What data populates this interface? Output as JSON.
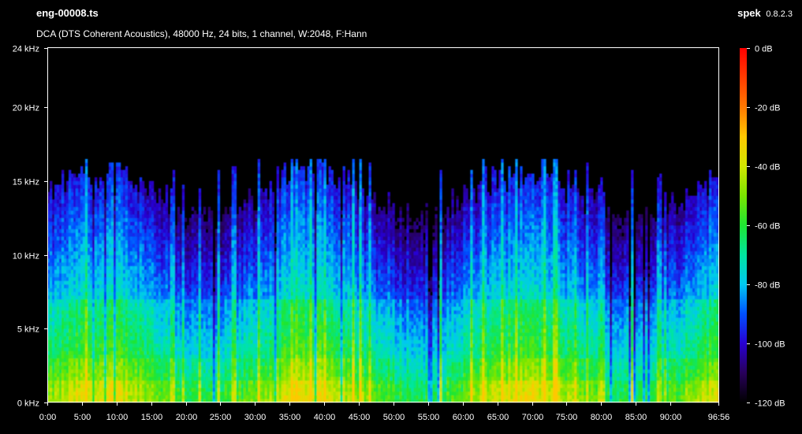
{
  "header": {
    "file_name": "eng-00008.ts",
    "app_name": "spek",
    "app_version": "0.8.2.3",
    "info": "DCA (DTS Coherent Acoustics), 48000 Hz, 24 bits, 1 channel, W:2048, F:Hann"
  },
  "chart_data": {
    "type": "heatmap",
    "title": "",
    "xlabel": "",
    "ylabel": "",
    "x_unit": "time (min:sec)",
    "y_unit": "kHz",
    "xlim_seconds": [
      0,
      5816
    ],
    "ylim_khz": [
      0,
      24
    ],
    "x_ticks": [
      {
        "label": "0:00",
        "seconds": 0
      },
      {
        "label": "5:00",
        "seconds": 300
      },
      {
        "label": "10:00",
        "seconds": 600
      },
      {
        "label": "15:00",
        "seconds": 900
      },
      {
        "label": "20:00",
        "seconds": 1200
      },
      {
        "label": "25:00",
        "seconds": 1500
      },
      {
        "label": "30:00",
        "seconds": 1800
      },
      {
        "label": "35:00",
        "seconds": 2100
      },
      {
        "label": "40:00",
        "seconds": 2400
      },
      {
        "label": "45:00",
        "seconds": 2700
      },
      {
        "label": "50:00",
        "seconds": 3000
      },
      {
        "label": "55:00",
        "seconds": 3300
      },
      {
        "label": "60:00",
        "seconds": 3600
      },
      {
        "label": "65:00",
        "seconds": 3900
      },
      {
        "label": "70:00",
        "seconds": 4200
      },
      {
        "label": "75:00",
        "seconds": 4500
      },
      {
        "label": "80:00",
        "seconds": 4800
      },
      {
        "label": "85:00",
        "seconds": 5100
      },
      {
        "label": "90:00",
        "seconds": 5400
      },
      {
        "label": "96:56",
        "seconds": 5816
      }
    ],
    "y_ticks": [
      {
        "label": "0 kHz",
        "khz": 0
      },
      {
        "label": "5 kHz",
        "khz": 5
      },
      {
        "label": "10 kHz",
        "khz": 10
      },
      {
        "label": "15 kHz",
        "khz": 15
      },
      {
        "label": "20 kHz",
        "khz": 20
      },
      {
        "label": "24 kHz",
        "khz": 24
      }
    ],
    "color_scale": {
      "unit": "dB",
      "range": [
        -120,
        0
      ],
      "ticks": [
        {
          "label": "0 dB",
          "db": 0
        },
        {
          "label": "-20 dB",
          "db": -20
        },
        {
          "label": "-40 dB",
          "db": -40
        },
        {
          "label": "-60 dB",
          "db": -60
        },
        {
          "label": "-80 dB",
          "db": -80
        },
        {
          "label": "-100 dB",
          "db": -100
        },
        {
          "label": "-120 dB",
          "db": -120
        }
      ],
      "stops": [
        {
          "db": -120,
          "color": "#000000"
        },
        {
          "db": -110,
          "color": "#28005a"
        },
        {
          "db": -100,
          "color": "#2800d2"
        },
        {
          "db": -90,
          "color": "#0050ff"
        },
        {
          "db": -80,
          "color": "#00c8f0"
        },
        {
          "db": -70,
          "color": "#00e6a0"
        },
        {
          "db": -60,
          "color": "#1ee632"
        },
        {
          "db": -50,
          "color": "#7ae600"
        },
        {
          "db": -40,
          "color": "#d2e600"
        },
        {
          "db": -30,
          "color": "#ffc800"
        },
        {
          "db": -20,
          "color": "#ff7800"
        },
        {
          "db": -10,
          "color": "#ff3c00"
        },
        {
          "db": 0,
          "color": "#ff0000"
        }
      ]
    },
    "grid": false,
    "content_summary": {
      "energy_upper_limit_khz": 16,
      "strongest_band_khz": [
        0,
        1.5
      ]
    }
  }
}
